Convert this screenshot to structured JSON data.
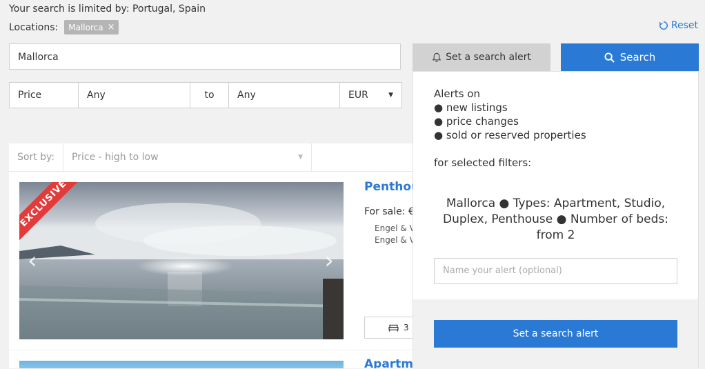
{
  "header": {
    "limit_text": "Your search is limited by: Portugal, Spain",
    "locations_label": "Locations:",
    "location_tag": "Mallorca",
    "tag_remove": "×",
    "reset_label": "Reset"
  },
  "search": {
    "value": "Mallorca",
    "alert_tab_label": "Set a search alert",
    "search_button_label": "Search"
  },
  "price_filter": {
    "label": "Price",
    "min": "Any",
    "to": "to",
    "max": "Any",
    "currency": "EUR"
  },
  "sort": {
    "label": "Sort by:",
    "selected": "Price - high to low"
  },
  "listings": [
    {
      "ribbon": "EXCLUSIVE",
      "title": "Penthouse",
      "for_sale": "For sale: €",
      "agent_line_1": "Engel & V",
      "agent_line_2": "Engel & V",
      "beds": "3"
    },
    {
      "title": "Apartment"
    }
  ],
  "alert_panel": {
    "heading": "Alerts on",
    "items": [
      "new listings",
      "price changes",
      "sold or reserved properties"
    ],
    "filters_label": "for selected filters:",
    "filters_summary": "Mallorca ● Types: Apartment, Studio, Duplex, Penthouse ● Number of beds: from 2",
    "name_placeholder": "Name your alert (optional)",
    "submit_label": "Set a search alert"
  },
  "colors": {
    "accent": "#2a7ad5",
    "ribbon": "#e23b3b",
    "background": "#f1f1f1"
  }
}
